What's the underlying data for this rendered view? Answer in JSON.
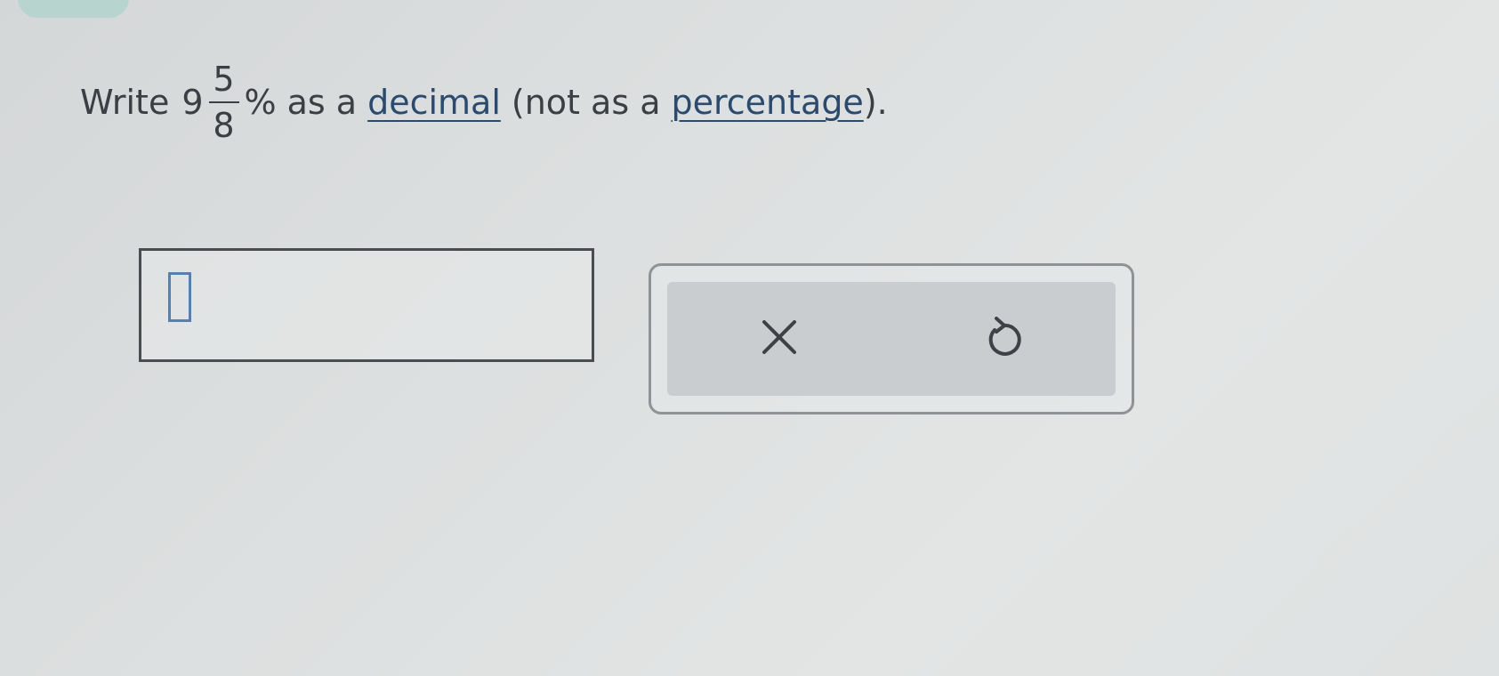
{
  "question": {
    "prefix": "Write",
    "whole_number": "9",
    "fraction_numerator": "5",
    "fraction_denominator": "8",
    "percent_sign": "%",
    "middle_text": "as a",
    "link_decimal": "decimal",
    "open_paren_text": "(not as a",
    "link_percentage": "percentage",
    "suffix": ")."
  },
  "answer": {
    "value": ""
  },
  "actions": {
    "clear_icon": "x-icon",
    "undo_icon": "undo-icon"
  },
  "colors": {
    "link": "#2b4a6e",
    "cursor": "#5a7fa8",
    "panel_bg": "#c9cdd0",
    "tab": "#b7d4cf"
  }
}
